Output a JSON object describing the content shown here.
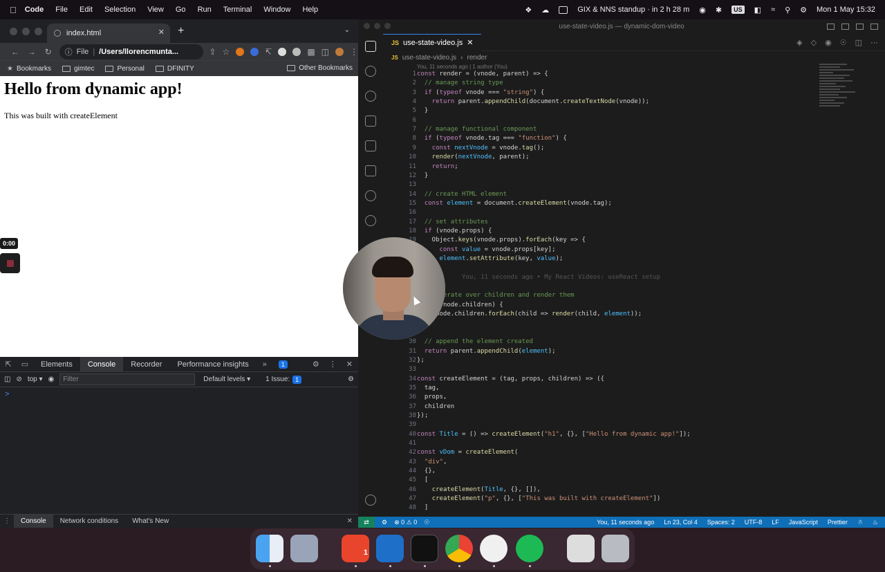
{
  "menubar": {
    "app": "Code",
    "items": [
      "File",
      "Edit",
      "Selection",
      "View",
      "Go",
      "Run",
      "Terminal",
      "Window",
      "Help"
    ],
    "event": "GIX & NNS standup · in 2 h 28 m",
    "input_source": "US",
    "datetime": "Mon 1 May  15:32"
  },
  "chrome": {
    "tab_title": "index.html",
    "url_scheme": "File",
    "url_path": "/Users/llorencmunta...",
    "bookmarks": [
      "Bookmarks",
      "gimtec",
      "Personal",
      "DFINITY"
    ],
    "other_bookmarks": "Other Bookmarks",
    "page_heading": "Hello from dynamic app!",
    "page_paragraph": "This was built with createElement",
    "timer": "0:00"
  },
  "devtools": {
    "tabs": [
      "Elements",
      "Console",
      "Recorder",
      "Performance insights"
    ],
    "issue_count": "1",
    "context": "top",
    "filter_placeholder": "Filter",
    "levels": "Default levels",
    "issues_label": "1 Issue:",
    "issues_badge": "1",
    "prompt": ">",
    "drawer_tabs": [
      "Console",
      "Network conditions",
      "What's New"
    ]
  },
  "vscode": {
    "window_title": "use-state-video.js — dynamic-dom-video",
    "tab": "use-state-video.js",
    "breadcrumb_file": "use-state-video.js",
    "breadcrumb_symbol": "render",
    "blame_header": "You, 11 seconds ago | 1 author (You)",
    "status": {
      "problems": "⊗ 0 ⚠ 0",
      "blame": "You, 11 seconds ago",
      "position": "Ln 23, Col 4",
      "spaces": "Spaces: 2",
      "encoding": "UTF-8",
      "eol": "LF",
      "language": "JavaScript",
      "formatter": "Prettier"
    },
    "lines": [
      {
        "n": "1",
        "t": "const render = (vnode, parent) => {"
      },
      {
        "n": "2",
        "t": "  // manage string type"
      },
      {
        "n": "3",
        "t": "  if (typeof vnode === \"string\") {"
      },
      {
        "n": "4",
        "t": "    return parent.appendChild(document.createTextNode(vnode));"
      },
      {
        "n": "5",
        "t": "  }"
      },
      {
        "n": "6",
        "t": ""
      },
      {
        "n": "7",
        "t": "  // manage functional component"
      },
      {
        "n": "8",
        "t": "  if (typeof vnode.tag === \"function\") {"
      },
      {
        "n": "9",
        "t": "    const nextVnode = vnode.tag();"
      },
      {
        "n": "10",
        "t": "    render(nextVnode, parent);"
      },
      {
        "n": "11",
        "t": "    return;"
      },
      {
        "n": "12",
        "t": "  }"
      },
      {
        "n": "13",
        "t": ""
      },
      {
        "n": "14",
        "t": "  // create HTML element"
      },
      {
        "n": "15",
        "t": "  const element = document.createElement(vnode.tag);"
      },
      {
        "n": "16",
        "t": ""
      },
      {
        "n": "17",
        "t": "  // set attributes"
      },
      {
        "n": "18",
        "t": "  if (vnode.props) {"
      },
      {
        "n": "19",
        "t": "    Object.keys(vnode.props).forEach(key => {"
      },
      {
        "n": "20",
        "t": "      const value = vnode.props[key];"
      },
      {
        "n": "21",
        "t": "      element.setAttribute(key, value);"
      },
      {
        "n": "22",
        "t": ""
      },
      {
        "n": "23",
        "t": "            You, 11 seconds ago • My React Videos: useReact setup"
      },
      {
        "n": "24",
        "t": ""
      },
      {
        "n": "25",
        "t": "  // iterate over children and render them"
      },
      {
        "n": "26",
        "t": "  if (vnode.children) {"
      },
      {
        "n": "27",
        "t": "    vnode.children.forEach(child => render(child, element));"
      },
      {
        "n": "28",
        "t": ""
      },
      {
        "n": "29",
        "t": ""
      },
      {
        "n": "30",
        "t": "  // append the element created"
      },
      {
        "n": "31",
        "t": "  return parent.appendChild(element);"
      },
      {
        "n": "32",
        "t": "};"
      },
      {
        "n": "33",
        "t": ""
      },
      {
        "n": "34",
        "t": "const createElement = (tag, props, children) => ({"
      },
      {
        "n": "35",
        "t": "  tag,"
      },
      {
        "n": "36",
        "t": "  props,"
      },
      {
        "n": "37",
        "t": "  children"
      },
      {
        "n": "38",
        "t": "});"
      },
      {
        "n": "39",
        "t": ""
      },
      {
        "n": "40",
        "t": "const Title = () => createElement(\"h1\", {}, [\"Hello from dynamic app!\"]);"
      },
      {
        "n": "41",
        "t": ""
      },
      {
        "n": "42",
        "t": "const vDom = createElement("
      },
      {
        "n": "43",
        "t": "  \"div\","
      },
      {
        "n": "44",
        "t": "  {},"
      },
      {
        "n": "45",
        "t": "  ["
      },
      {
        "n": "46",
        "t": "    createElement(Title, {}, []),"
      },
      {
        "n": "47",
        "t": "    createElement(\"p\", {}, [\"This was built with createElement\"])"
      },
      {
        "n": "48",
        "t": "  ]"
      }
    ]
  },
  "dock": {
    "apps": [
      "finder-icon",
      "launchpad-icon",
      "calendar-icon",
      "vscode-icon",
      "terminal-icon",
      "chrome-icon",
      "github-icon",
      "spotify-icon",
      "preview-icon",
      "trash-icon"
    ],
    "calendar_badge": "1"
  },
  "colors": {
    "vscode_status": "#0f6fb8",
    "accent": "#1a73e8"
  }
}
